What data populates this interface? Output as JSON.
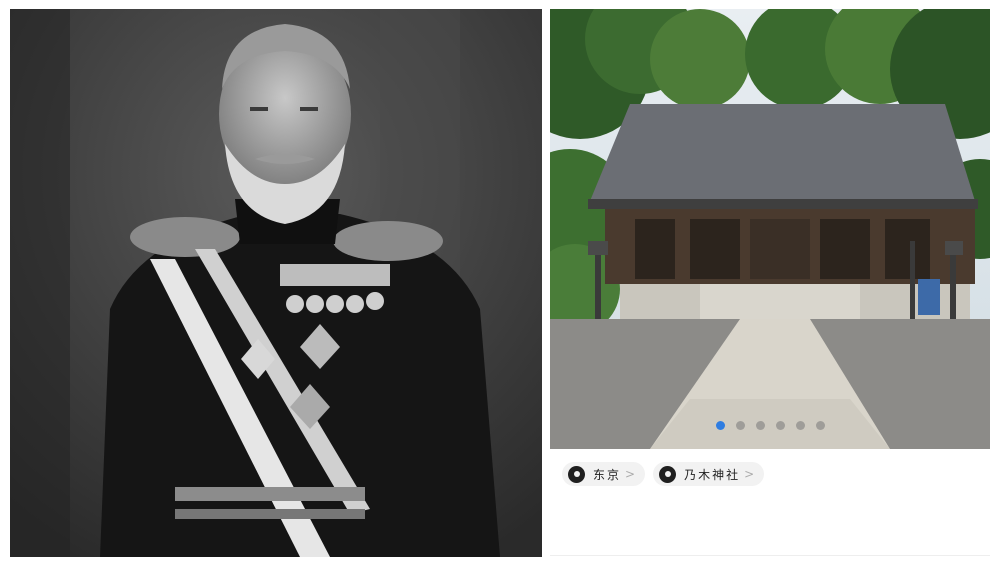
{
  "left_photo": {
    "icon": "portrait-photo",
    "description_visible_text": ""
  },
  "carousel": {
    "icon": "shrine-photo",
    "slide_count": 6,
    "active_index": 0,
    "active_color": "#2f7de1"
  },
  "tags": [
    {
      "icon": "location-pin-icon",
      "label": "东京"
    },
    {
      "icon": "location-pin-icon",
      "label": "乃木神社"
    }
  ]
}
